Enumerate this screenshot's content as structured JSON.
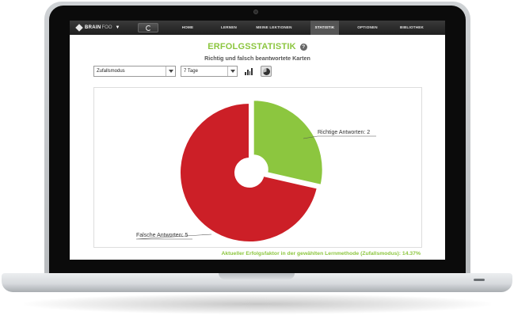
{
  "navbar": {
    "logo_bold": "BRAIN",
    "logo_light": "FOO",
    "items": [
      {
        "label": "HOME",
        "active": false
      },
      {
        "label": "LERNEN",
        "active": false
      },
      {
        "label": "MEINE LEKTIONEN",
        "active": false
      },
      {
        "label": "STATISTIK",
        "active": true
      },
      {
        "label": "OPTIONEN",
        "active": false
      },
      {
        "label": "BIBLIOTHEK",
        "active": false
      }
    ]
  },
  "page": {
    "title": "ERFOLGSSTATISTIK",
    "help_glyph": "?",
    "subtitle": "Richtig und falsch beantwortete Karten"
  },
  "filters": {
    "mode_value": "Zufallsmodus",
    "period_value": "7 Tage"
  },
  "chart_data": {
    "type": "pie",
    "variant": "donut",
    "slices": [
      {
        "label": "Richtige Antworten",
        "value": 2,
        "color": "#8cc63f",
        "exploded": true
      },
      {
        "label": "Falsche Antworten",
        "value": 5,
        "color": "#cc1f27",
        "exploded": false
      }
    ],
    "data_labels": [
      "Richtige Antworten: 2",
      "Falsche Antworten: 5"
    ]
  },
  "footer": {
    "success_factor": "Aktueller Erfolgsfaktor in der gewählten Lernmethode (Zufallsmodus): 14.37%"
  },
  "colors": {
    "accent": "#8cc63f",
    "wrong": "#cc1f27",
    "navbar": "#2a2a2a"
  }
}
